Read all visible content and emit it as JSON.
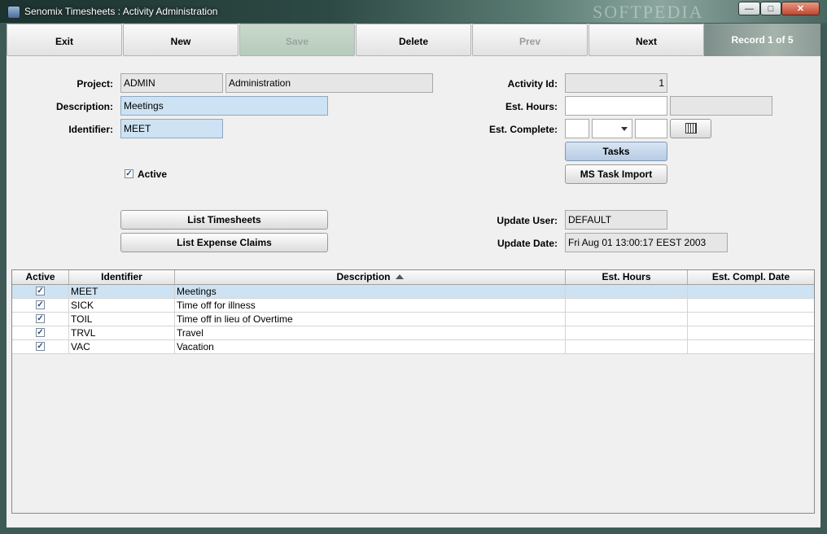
{
  "window": {
    "title": "Senomix Timesheets : Activity Administration",
    "watermark": "SOFTPEDIA",
    "min_glyph": "—",
    "max_glyph": "□",
    "close_glyph": "✕"
  },
  "toolbar": {
    "exit": "Exit",
    "new": "New",
    "save": "Save",
    "delete": "Delete",
    "prev": "Prev",
    "next": "Next",
    "record": "Record 1 of 5"
  },
  "form": {
    "project_label": "Project:",
    "project_code": "ADMIN",
    "project_name": "Administration",
    "description_label": "Description:",
    "description_value": "Meetings",
    "identifier_label": "Identifier:",
    "identifier_value": "MEET",
    "active_label": "Active",
    "active_checked": "✓",
    "activity_id_label": "Activity Id:",
    "activity_id_value": "1",
    "est_hours_label": "Est. Hours:",
    "est_hours_value": "",
    "est_hours_extra": "",
    "est_complete_label": "Est. Complete:",
    "est_complete_day": "",
    "est_complete_month": "",
    "est_complete_year": "",
    "tasks_button": "Tasks",
    "ms_task_import_button": "MS Task Import",
    "list_timesheets_button": "List Timesheets",
    "list_expense_claims_button": "List Expense Claims",
    "update_user_label": "Update User:",
    "update_user_value": "DEFAULT",
    "update_date_label": "Update Date:",
    "update_date_value": "Fri Aug 01 13:00:17 EEST 2003"
  },
  "table": {
    "columns": [
      "Active",
      "Identifier",
      "Description",
      "Est. Hours",
      "Est. Compl. Date"
    ],
    "sorted_column": "Description",
    "rows": [
      {
        "active": "✓",
        "identifier": "MEET",
        "description": "Meetings",
        "est_hours": "",
        "est_compl_date": ""
      },
      {
        "active": "✓",
        "identifier": "SICK",
        "description": "Time off for illness",
        "est_hours": "",
        "est_compl_date": ""
      },
      {
        "active": "✓",
        "identifier": "TOIL",
        "description": "Time off in lieu of Overtime",
        "est_hours": "",
        "est_compl_date": ""
      },
      {
        "active": "✓",
        "identifier": "TRVL",
        "description": "Travel",
        "est_hours": "",
        "est_compl_date": ""
      },
      {
        "active": "✓",
        "identifier": "VAC",
        "description": "Vacation",
        "est_hours": "",
        "est_compl_date": ""
      }
    ]
  },
  "colors": {
    "selection": "#cde2f2",
    "panel": "#f0f0f0",
    "save_disabled": "#b6cbbd"
  }
}
